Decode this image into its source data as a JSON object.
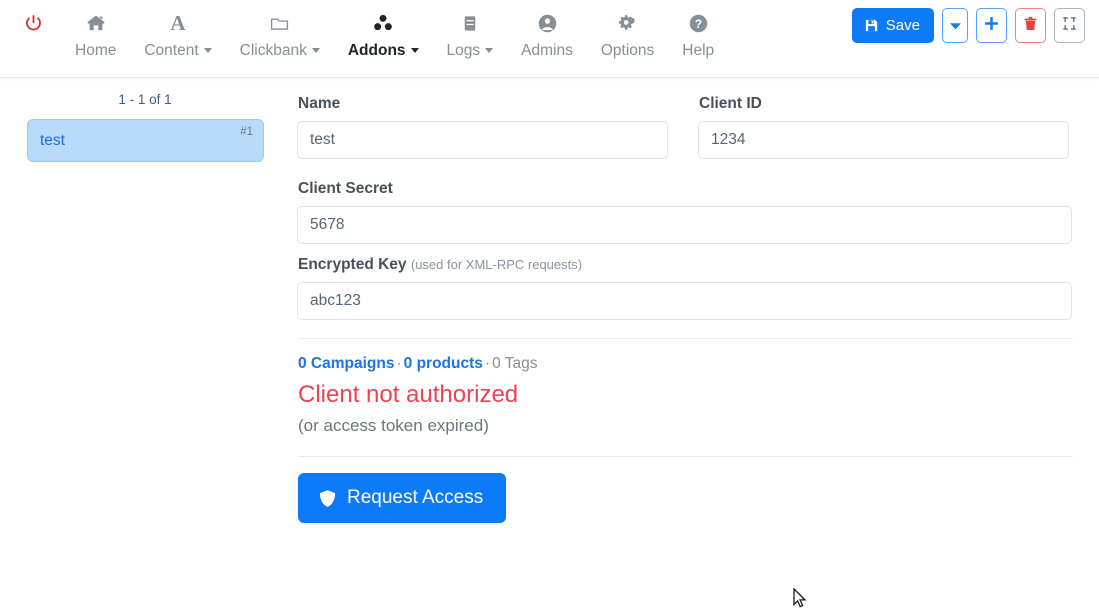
{
  "nav": {
    "items": [
      {
        "label": "",
        "icon": "power-icon",
        "name": "nav-power",
        "active": false,
        "caret": false
      },
      {
        "label": "Home",
        "icon": "home-icon",
        "name": "nav-home",
        "active": false,
        "caret": false
      },
      {
        "label": "Content",
        "icon": "letter-a-icon",
        "name": "nav-content",
        "active": false,
        "caret": true
      },
      {
        "label": "Clickbank",
        "icon": "folder-icon",
        "name": "nav-clickbank",
        "active": false,
        "caret": true
      },
      {
        "label": "Addons",
        "icon": "addons-icon",
        "name": "nav-addons",
        "active": true,
        "caret": true
      },
      {
        "label": "Logs",
        "icon": "server-icon",
        "name": "nav-logs",
        "active": false,
        "caret": true
      },
      {
        "label": "Admins",
        "icon": "user-circle-icon",
        "name": "nav-admins",
        "active": false,
        "caret": false
      },
      {
        "label": "Options",
        "icon": "cogs-icon",
        "name": "nav-options",
        "active": false,
        "caret": false
      },
      {
        "label": "Help",
        "icon": "question-circle-icon",
        "name": "nav-help",
        "active": false,
        "caret": false
      }
    ]
  },
  "actions": {
    "save_label": "Save",
    "save_icon": "floppy-save-icon",
    "dropdown_icon": "caret-down-icon",
    "add_icon": "plus-icon",
    "delete_icon": "trash-icon",
    "collapse_icon": "compress-icon"
  },
  "sidebar": {
    "pager": "1 - 1 of 1",
    "items": [
      {
        "name": "test",
        "index": "#1",
        "selected": true
      }
    ]
  },
  "form": {
    "name": {
      "label": "Name",
      "value": "test",
      "placeholder": "Name"
    },
    "client_id": {
      "label": "Client ID",
      "value": "1234",
      "placeholder": "Client ID"
    },
    "client_secret": {
      "label": "Client Secret",
      "value": "5678",
      "placeholder": "Client Secret"
    },
    "encrypted_key": {
      "label": "Encrypted Key",
      "hint": "(used for XML-RPC requests)",
      "value": "abc123",
      "placeholder": "Encrypted Key"
    }
  },
  "status": {
    "campaigns_link": "0 Campaigns",
    "sep1": "·",
    "products_link": "0 products",
    "sep2": "·",
    "tags_text": "0 Tags",
    "error": "Client not authorized",
    "error_sub": "(or access token expired)"
  },
  "request": {
    "label": "Request Access",
    "icon": "shield-icon"
  },
  "colors": {
    "accent": "#0d7bf7",
    "link": "#1a73e8",
    "error": "#f04252",
    "power": "#e03131",
    "delete": "#f03e3e",
    "selected_item_bg": "#b9daf8",
    "selected_item_text": "#1d6fd6",
    "label": "#495057",
    "muted": "#868e96"
  }
}
